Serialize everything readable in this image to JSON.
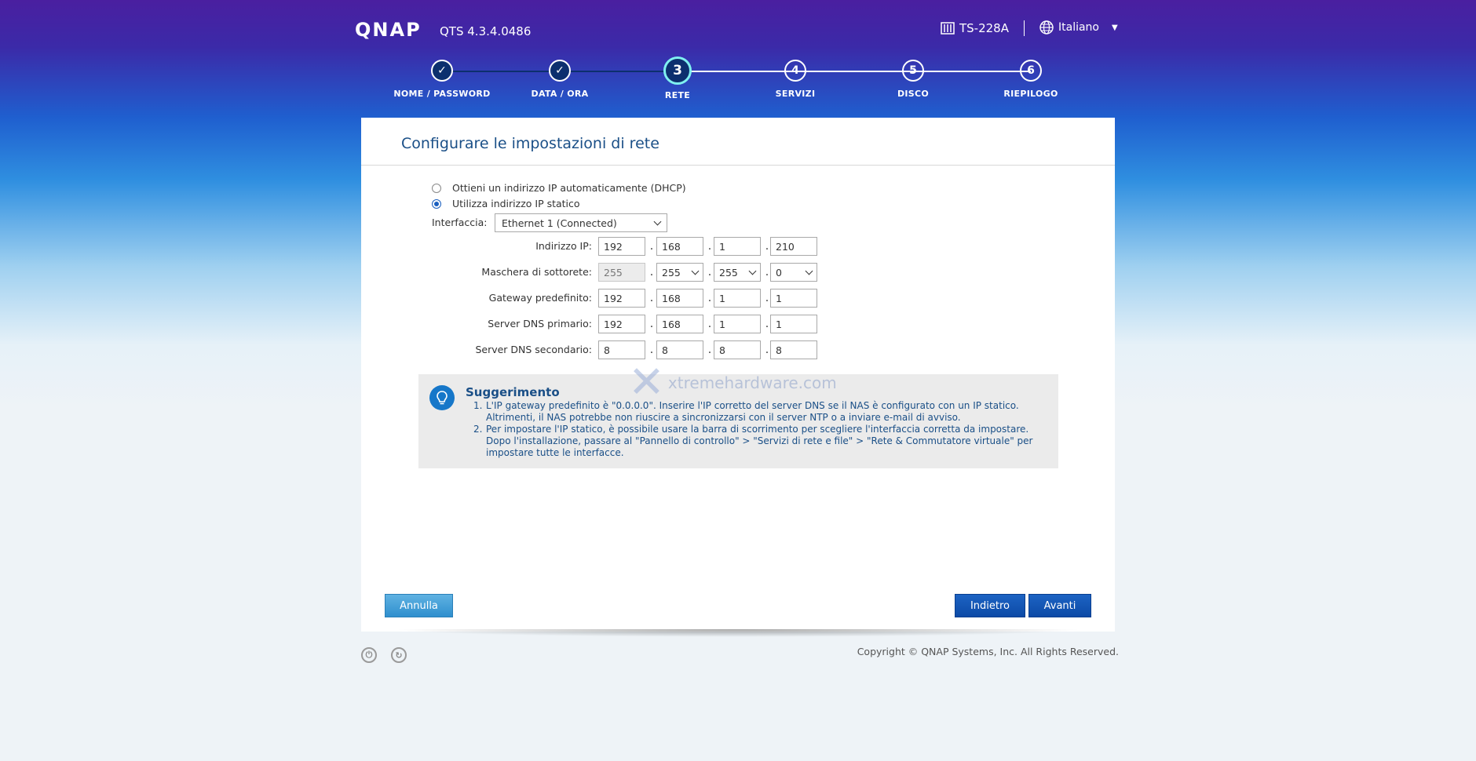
{
  "header": {
    "logo": "QNAP",
    "version": "QTS 4.3.4.0486",
    "model": "TS-228A",
    "language": "Italiano"
  },
  "steps": [
    {
      "number": "1",
      "label": "NOME / PASSWORD",
      "state": "done"
    },
    {
      "number": "2",
      "label": "DATA / ORA",
      "state": "done"
    },
    {
      "number": "3",
      "label": "RETE",
      "state": "current"
    },
    {
      "number": "4",
      "label": "SERVIZI",
      "state": "pending"
    },
    {
      "number": "5",
      "label": "DISCO",
      "state": "pending"
    },
    {
      "number": "6",
      "label": "RIEPILOGO",
      "state": "pending"
    }
  ],
  "form": {
    "title": "Configurare le impostazioni di rete",
    "dhcp_label": "Ottieni un indirizzo IP automaticamente (DHCP)",
    "static_label": "Utilizza indirizzo IP statico",
    "selected_mode": "static",
    "interface_label": "Interfaccia:",
    "interface_value": "Ethernet 1 (Connected)",
    "ip": {
      "label": "Indirizzo IP:",
      "octets": [
        "192",
        "168",
        "1",
        "210"
      ]
    },
    "mask": {
      "label": "Maschera di sottorete:",
      "octets": [
        "255",
        "255",
        "255",
        "0"
      ]
    },
    "gateway": {
      "label": "Gateway predefinito:",
      "octets": [
        "192",
        "168",
        "1",
        "1"
      ]
    },
    "dns1": {
      "label": "Server DNS primario:",
      "octets": [
        "192",
        "168",
        "1",
        "1"
      ]
    },
    "dns2": {
      "label": "Server DNS secondario:",
      "octets": [
        "8",
        "8",
        "8",
        "8"
      ]
    }
  },
  "tip": {
    "title": "Suggerimento",
    "items": [
      {
        "num": "1.",
        "text": "L'IP gateway predefinito è \"0.0.0.0\". Inserire l'IP corretto del server DNS se il NAS è configurato con un IP statico. Altrimenti, il NAS potrebbe non riuscire a sincronizzarsi con il server NTP o a inviare e-mail di avviso."
      },
      {
        "num": "2.",
        "text": "Per impostare l'IP statico, è possibile usare la barra di scorrimento per scegliere l'interfaccia corretta da impostare. Dopo l'installazione, passare al \"Pannello di controllo\" > \"Servizi di rete e file\" > \"Rete & Commutatore virtuale\" per impostare tutte le interfacce."
      }
    ]
  },
  "watermark": "xtremehardware.com",
  "buttons": {
    "cancel": "Annulla",
    "back": "Indietro",
    "next": "Avanti"
  },
  "footer": {
    "copyright": "Copyright © QNAP Systems, Inc. All Rights Reserved."
  },
  "colors": {
    "accent": "#0c4aa6",
    "title_blue": "#1a4f87",
    "step_done": "#0c2f6e",
    "step_current_ring": "#7ff0f0"
  }
}
